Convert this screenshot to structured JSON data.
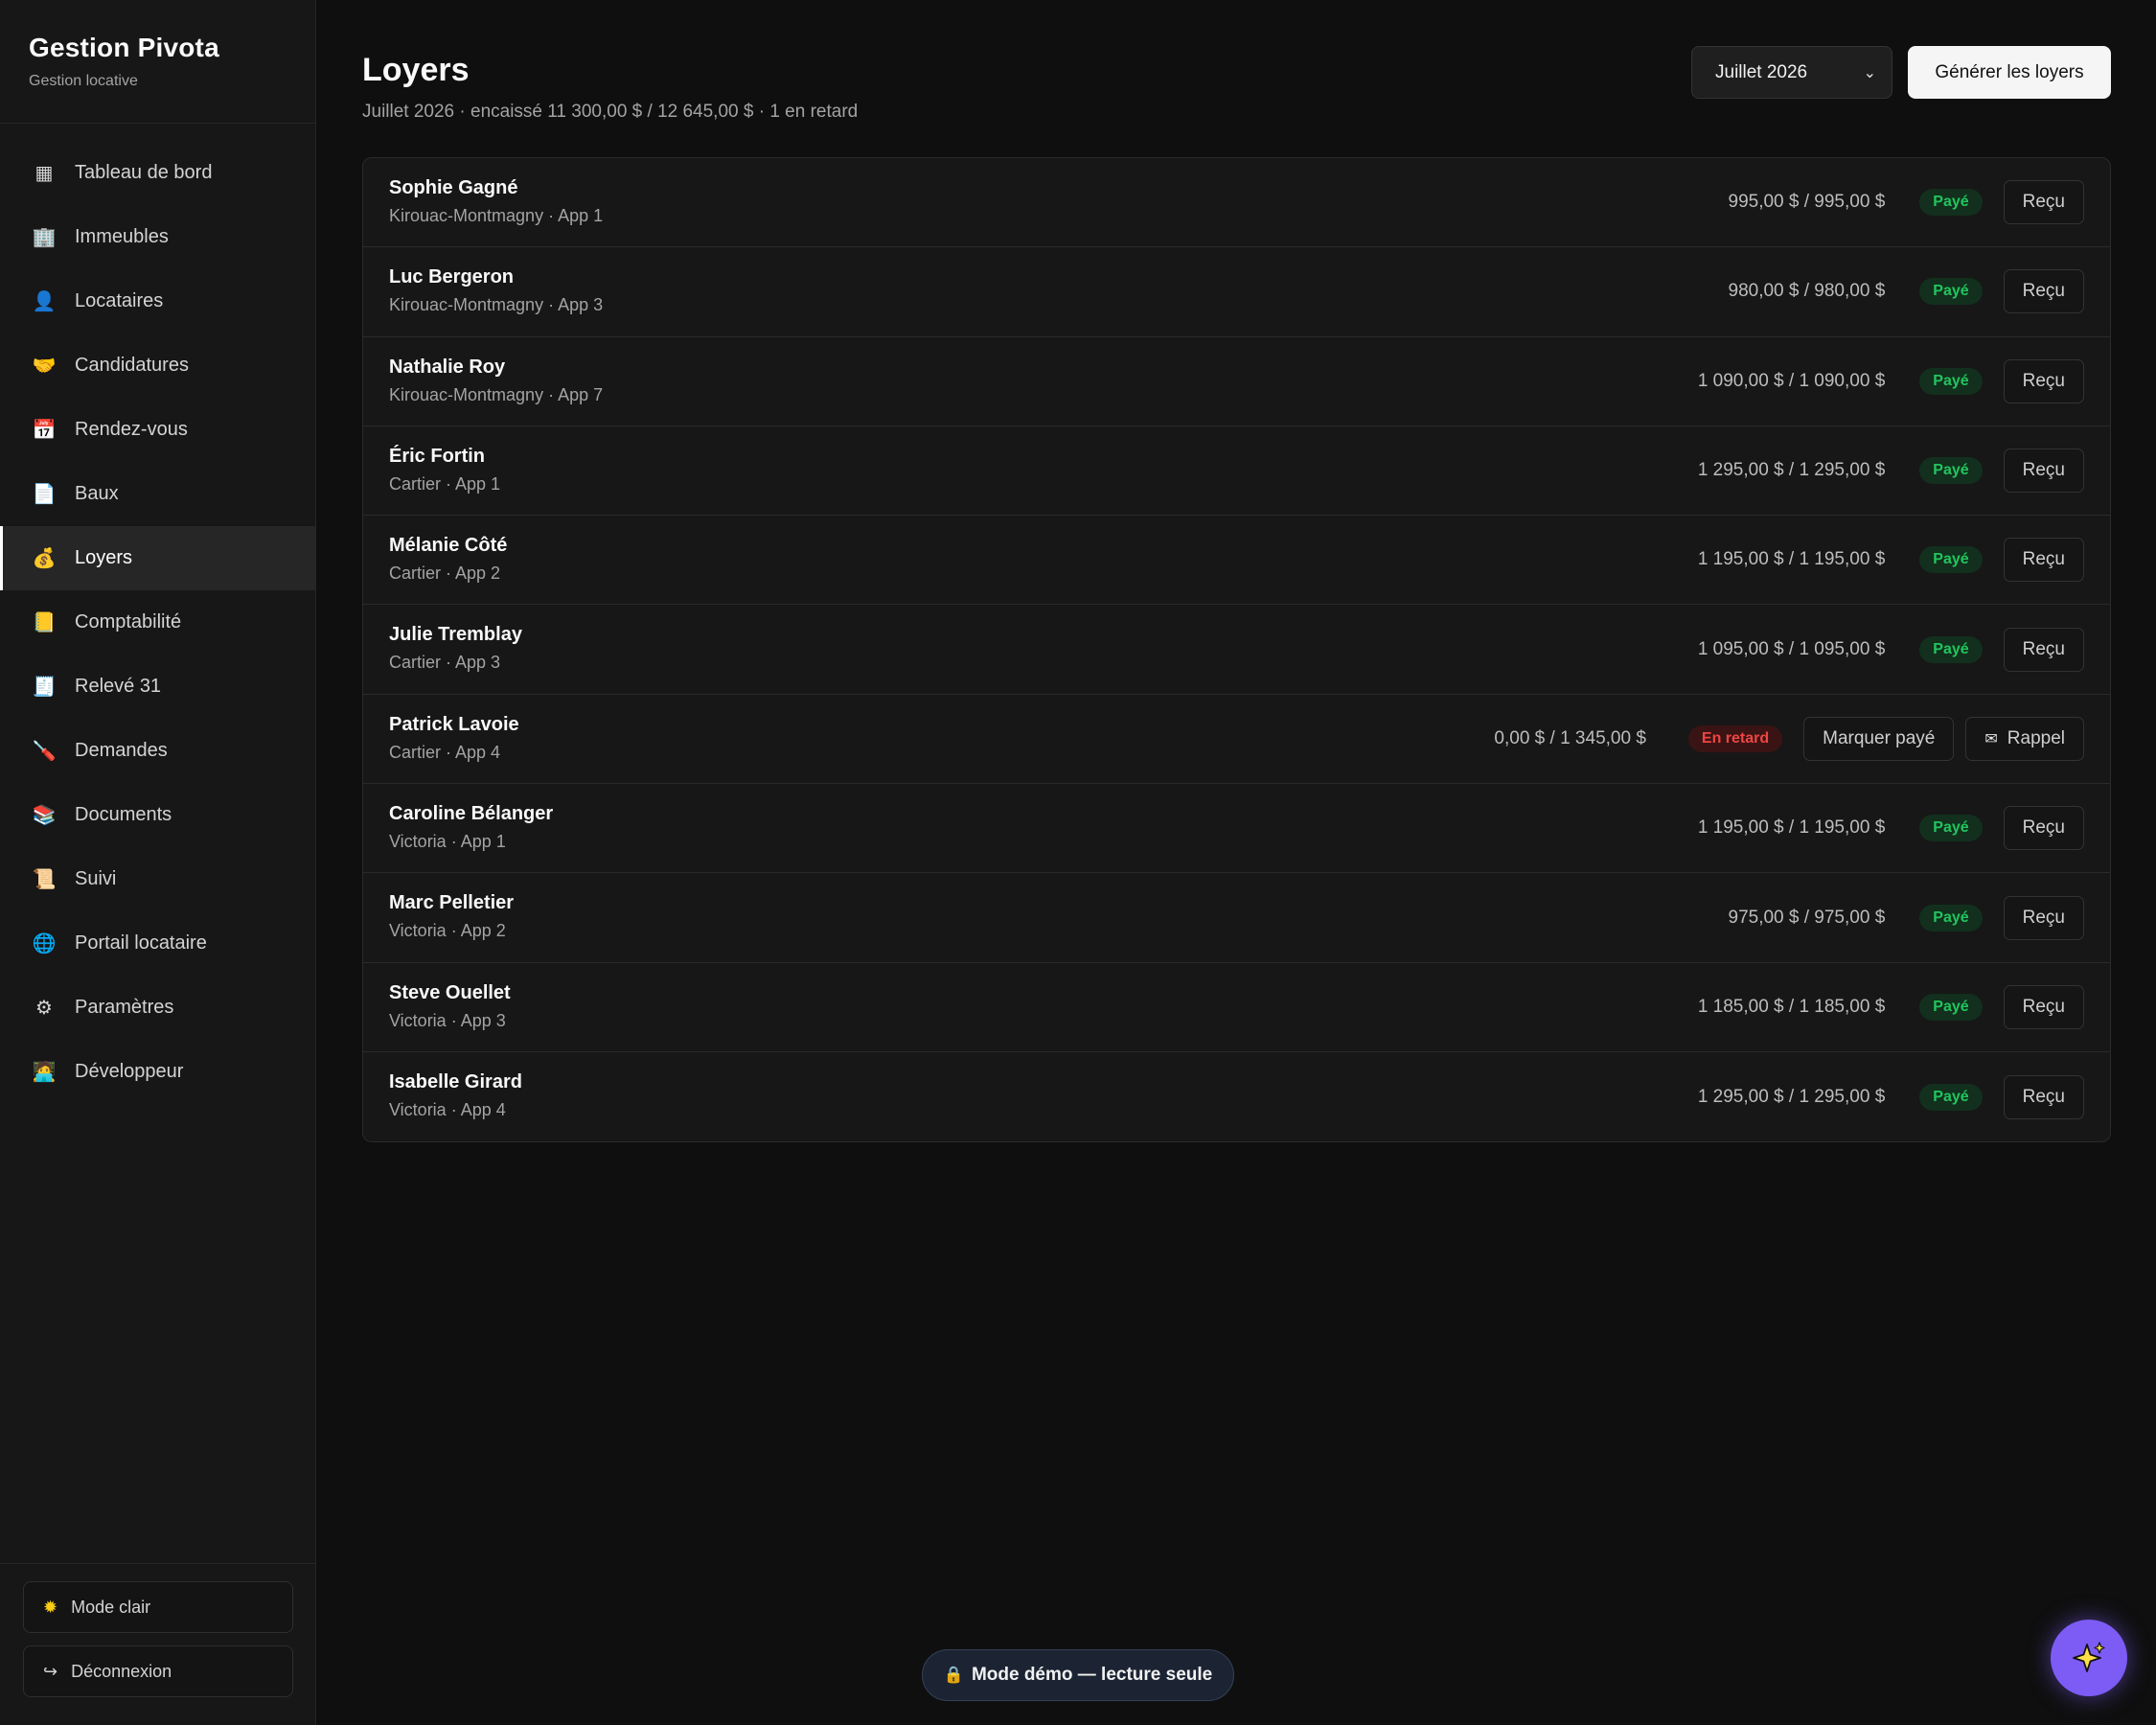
{
  "brand": {
    "title": "Gestion Pivota",
    "subtitle": "Gestion locative"
  },
  "nav": [
    {
      "label": "Tableau de bord",
      "icon": "grid-icon",
      "glyph": "▦"
    },
    {
      "label": "Immeubles",
      "icon": "building-icon",
      "glyph": "🏢"
    },
    {
      "label": "Locataires",
      "icon": "person-icon",
      "glyph": "👤"
    },
    {
      "label": "Candidatures",
      "icon": "handshake-icon",
      "glyph": "🤝"
    },
    {
      "label": "Rendez-vous",
      "icon": "calendar-icon",
      "glyph": "📅"
    },
    {
      "label": "Baux",
      "icon": "document-icon",
      "glyph": "📄"
    },
    {
      "label": "Loyers",
      "icon": "money-bag-icon",
      "glyph": "💰"
    },
    {
      "label": "Comptabilité",
      "icon": "ledger-icon",
      "glyph": "📒"
    },
    {
      "label": "Relevé 31",
      "icon": "receipt-icon",
      "glyph": "🧾"
    },
    {
      "label": "Demandes",
      "icon": "wrench-icon",
      "glyph": "🪛"
    },
    {
      "label": "Documents",
      "icon": "books-icon",
      "glyph": "📚"
    },
    {
      "label": "Suivi",
      "icon": "scroll-icon",
      "glyph": "📜"
    },
    {
      "label": "Portail locataire",
      "icon": "globe-icon",
      "glyph": "🌐"
    },
    {
      "label": "Paramètres",
      "icon": "gear-icon",
      "glyph": "⚙"
    },
    {
      "label": "Développeur",
      "icon": "developer-icon",
      "glyph": "🧑‍💻"
    }
  ],
  "active_nav": "Loyers",
  "sidebar_bottom": {
    "theme_label": "Mode clair",
    "logout_label": "Déconnexion"
  },
  "header": {
    "title": "Loyers",
    "subtitle": "Juillet 2026 · encaissé 11 300,00 $ / 12 645,00 $ · 1 en retard",
    "month_selected": "Juillet 2026",
    "generate_label": "Générer les loyers"
  },
  "rents": [
    {
      "name": "Sophie Gagné",
      "unit": "Kirouac-Montmagny · App 1",
      "amount": "995,00 $ / 995,00 $",
      "status": "Payé",
      "status_type": "paid",
      "actions": [
        "Reçu"
      ]
    },
    {
      "name": "Luc Bergeron",
      "unit": "Kirouac-Montmagny · App 3",
      "amount": "980,00 $ / 980,00 $",
      "status": "Payé",
      "status_type": "paid",
      "actions": [
        "Reçu"
      ]
    },
    {
      "name": "Nathalie Roy",
      "unit": "Kirouac-Montmagny · App 7",
      "amount": "1 090,00 $ / 1 090,00 $",
      "status": "Payé",
      "status_type": "paid",
      "actions": [
        "Reçu"
      ]
    },
    {
      "name": "Éric Fortin",
      "unit": "Cartier · App 1",
      "amount": "1 295,00 $ / 1 295,00 $",
      "status": "Payé",
      "status_type": "paid",
      "actions": [
        "Reçu"
      ]
    },
    {
      "name": "Mélanie Côté",
      "unit": "Cartier · App 2",
      "amount": "1 195,00 $ / 1 195,00 $",
      "status": "Payé",
      "status_type": "paid",
      "actions": [
        "Reçu"
      ]
    },
    {
      "name": "Julie Tremblay",
      "unit": "Cartier · App 3",
      "amount": "1 095,00 $ / 1 095,00 $",
      "status": "Payé",
      "status_type": "paid",
      "actions": [
        "Reçu"
      ]
    },
    {
      "name": "Patrick Lavoie",
      "unit": "Cartier · App 4",
      "amount": "0,00 $ / 1 345,00 $",
      "status": "En retard",
      "status_type": "late",
      "actions": [
        "Marquer payé",
        "Rappel"
      ]
    },
    {
      "name": "Caroline Bélanger",
      "unit": "Victoria · App 1",
      "amount": "1 195,00 $ / 1 195,00 $",
      "status": "Payé",
      "status_type": "paid",
      "actions": [
        "Reçu"
      ]
    },
    {
      "name": "Marc Pelletier",
      "unit": "Victoria · App 2",
      "amount": "975,00 $ / 975,00 $",
      "status": "Payé",
      "status_type": "paid",
      "actions": [
        "Reçu"
      ]
    },
    {
      "name": "Steve Ouellet",
      "unit": "Victoria · App 3",
      "amount": "1 185,00 $ / 1 185,00 $",
      "status": "Payé",
      "status_type": "paid",
      "actions": [
        "Reçu"
      ]
    },
    {
      "name": "Isabelle Girard",
      "unit": "Victoria · App 4",
      "amount": "1 295,00 $ / 1 295,00 $",
      "status": "Payé",
      "status_type": "paid",
      "actions": [
        "Reçu"
      ]
    }
  ],
  "demo_banner": "Mode démo — lecture seule",
  "colors": {
    "paid": "#22c55e",
    "late": "#ef4444",
    "accent": "#7c5cf5"
  }
}
